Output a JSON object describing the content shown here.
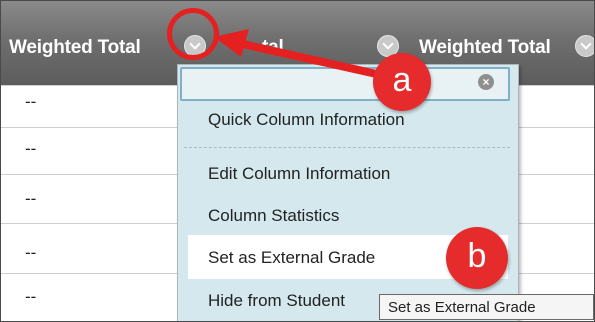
{
  "header": {
    "columns": [
      {
        "label": "Weighted Total"
      },
      {
        "label": "tal"
      },
      {
        "label": "Weighted Total"
      }
    ]
  },
  "rows": [
    {
      "value": "--"
    },
    {
      "value": "--"
    },
    {
      "value": "--"
    },
    {
      "value": "--"
    },
    {
      "value": "--"
    }
  ],
  "menu": {
    "search_value": "",
    "clear_symbol": "×",
    "items": [
      {
        "label": "Quick Column Information"
      },
      {
        "label": "Edit Column Information"
      },
      {
        "label": "Column Statistics"
      },
      {
        "label": "Set as External Grade"
      },
      {
        "label": "Hide from Student"
      }
    ]
  },
  "tooltip": {
    "text": "Set as External Grade"
  },
  "annotations": [
    {
      "label": "a",
      "color": "#e52b2b"
    },
    {
      "label": "b",
      "color": "#e52b2b"
    }
  ],
  "colors": {
    "header_bg": "#6f6f6f",
    "menu_bg": "#d4e8ed",
    "annotation": "#e52b2b"
  }
}
